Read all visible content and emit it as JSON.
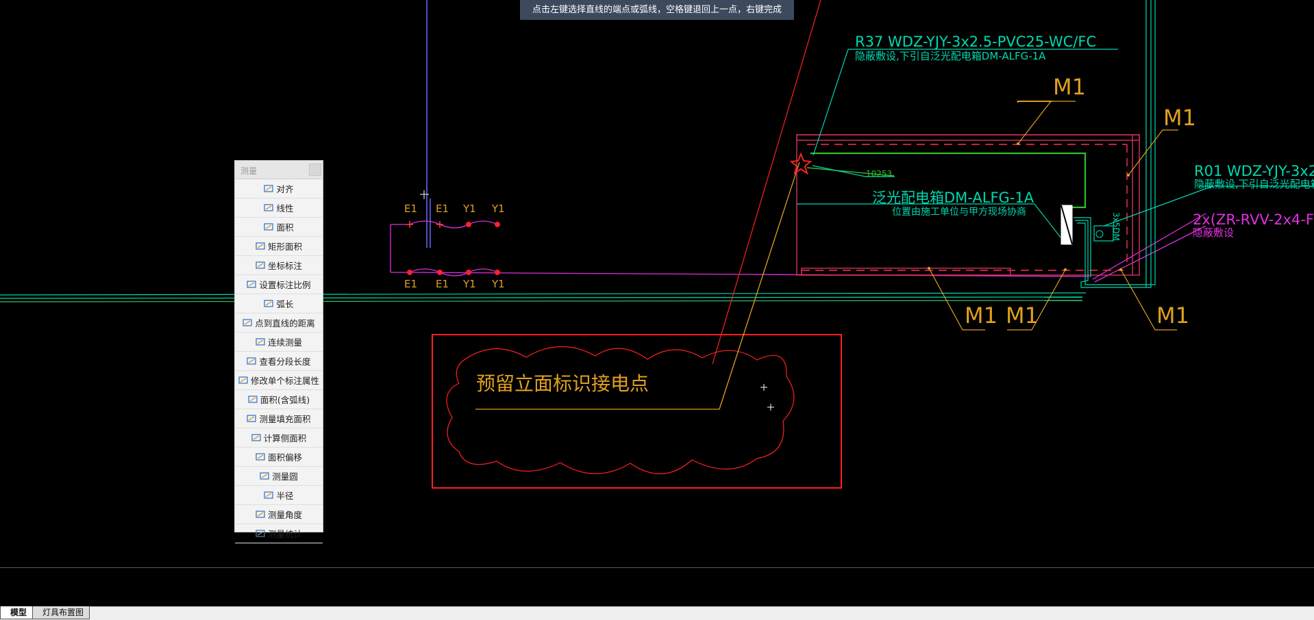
{
  "command_prompt": "点击左键选择直线的端点或弧线，空格键退回上一点，右键完成",
  "measure_panel": {
    "title": "测量",
    "tools": [
      {
        "label": "对齐",
        "icon": "align-measure-icon"
      },
      {
        "label": "线性",
        "icon": "linear-measure-icon"
      },
      {
        "label": "面积",
        "icon": "area-icon"
      },
      {
        "label": "矩形面积",
        "icon": "rect-area-icon"
      },
      {
        "label": "坐标标注",
        "icon": "coordinate-icon"
      },
      {
        "label": "设置标注比例",
        "icon": "scale-icon"
      },
      {
        "label": "弧长",
        "icon": "arc-length-icon"
      },
      {
        "label": "点到直线的距离",
        "icon": "point-line-icon"
      },
      {
        "label": "连续测量",
        "icon": "continuous-measure-icon"
      },
      {
        "label": "查看分段长度",
        "icon": "segment-length-icon"
      },
      {
        "label": "修改单个标注属性",
        "icon": "edit-annotation-icon"
      },
      {
        "label": "面积(含弧线)",
        "icon": "arc-area-icon"
      },
      {
        "label": "测量填充面积",
        "icon": "fill-area-icon"
      },
      {
        "label": "计算侧面积",
        "icon": "side-area-icon"
      },
      {
        "label": "面积偏移",
        "icon": "area-offset-icon"
      },
      {
        "label": "测量圆",
        "icon": "circle-measure-icon"
      },
      {
        "label": "半径",
        "icon": "radius-icon"
      },
      {
        "label": "测量角度",
        "icon": "angle-icon"
      },
      {
        "label": "测量统计",
        "icon": "statistics-icon"
      }
    ]
  },
  "drawing": {
    "circuit_top": "R37 WDZ-YJY-3x2.5-PVC25-WC/FC",
    "circuit_top_note": "隐蔽敷设,下引自泛光配电箱DM-ALFG-1A",
    "circuit_right": "R01 WDZ-YJY-3x2",
    "circuit_right_note": "隐蔽敷设,下引自泛光配电箱DM-",
    "cable_right": "2x(ZR-RVV-2x4-F",
    "cable_right_note": "隐蔽敷设",
    "box_label": "泛光配电箱DM-ALFG-1A",
    "box_note": "位置由施工单位与甲方现场协商",
    "dimension": "10253",
    "device_tag": "3x5DM",
    "m1_labels": [
      "M1",
      "M1",
      "M1",
      "M1",
      "M1"
    ],
    "legend_top_labels": [
      "E1",
      "E1",
      "Y1",
      "Y1"
    ],
    "legend_bottom_labels": [
      "E1",
      "E1",
      "Y1",
      "Y1"
    ],
    "cloud_text": "预留立面标识接电点"
  },
  "layout_tabs": [
    "模型",
    "灯具布置图"
  ],
  "colors": {
    "background": "#000000",
    "cyan": "#00e0b8",
    "yellow": "#e0a020",
    "magenta": "#e030e0",
    "red": "#ff2020",
    "green": "#30c030",
    "blue": "#6060ff"
  }
}
